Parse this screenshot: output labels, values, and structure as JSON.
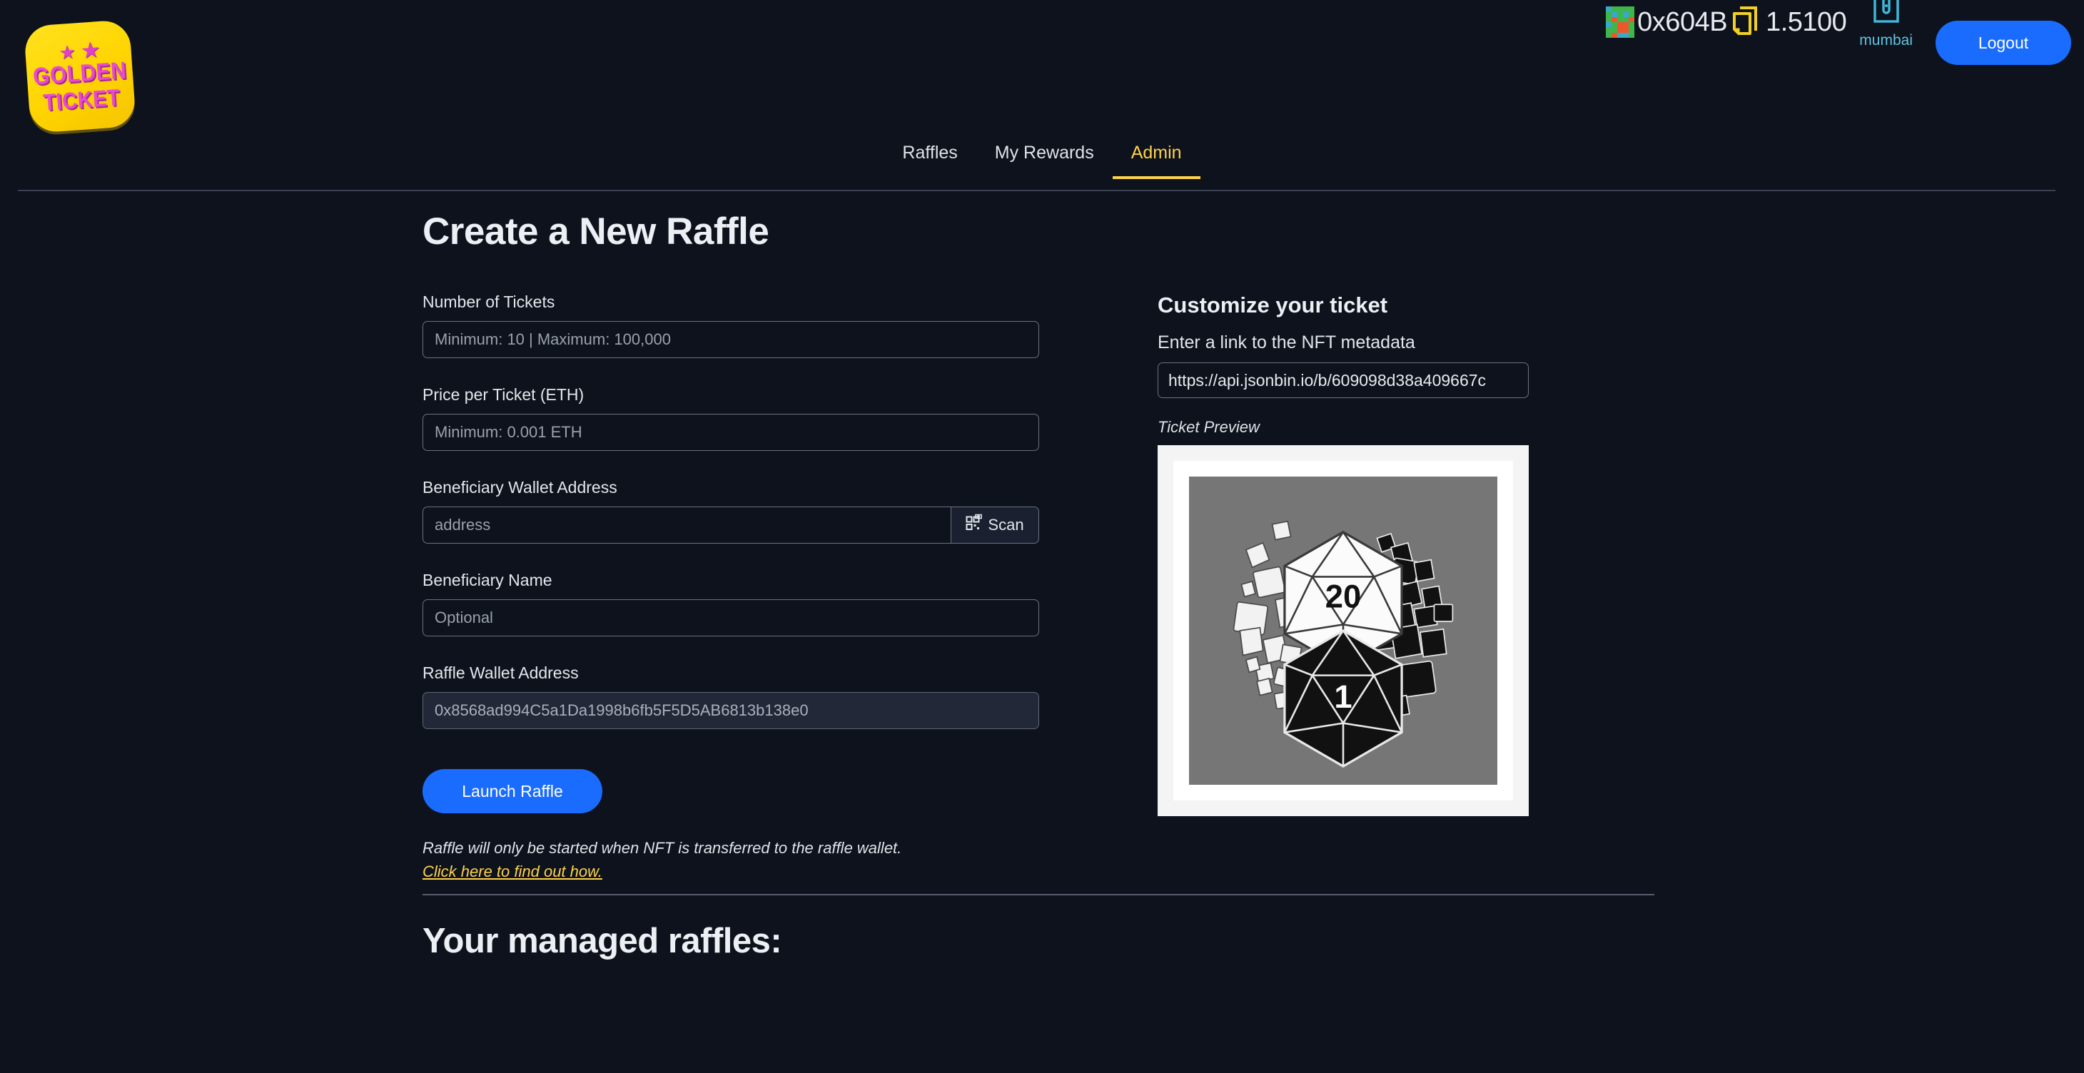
{
  "brand": {
    "logo_star": "★",
    "logo_line1": "GOLDEN",
    "logo_line2": "TICKET",
    "logo_bg": "#ffd400",
    "logo_text_color": "#e84ad0"
  },
  "header": {
    "wallet_address": "0x604B",
    "balance": "1.5100",
    "network": "mumbai",
    "logout_label": "Logout",
    "identicon_name": "identicon-avatar",
    "ticket_icon_color": "#f2d024",
    "network_icon_color": "#3fb6d8",
    "accent_blue": "#1a6cff"
  },
  "nav": {
    "items": [
      {
        "label": "Raffles",
        "active": false
      },
      {
        "label": "My Rewards",
        "active": false
      },
      {
        "label": "Admin",
        "active": true
      }
    ],
    "active_color": "#ffd24a"
  },
  "main": {
    "page_title": "Create a New Raffle",
    "fields": {
      "tickets": {
        "label": "Number of Tickets",
        "placeholder": "Minimum: 10 | Maximum: 100,000",
        "value": ""
      },
      "price": {
        "label": "Price per Ticket (ETH)",
        "placeholder": "Minimum: 0.001 ETH",
        "value": ""
      },
      "beneficiary_address": {
        "label": "Beneficiary Wallet Address",
        "placeholder": "address",
        "value": "",
        "scan_label": "Scan"
      },
      "beneficiary_name": {
        "label": "Beneficiary Name",
        "placeholder": "Optional",
        "value": ""
      },
      "raffle_wallet": {
        "label": "Raffle Wallet Address",
        "placeholder": "0x8568ad994C5a1Da1998b6fb5F5D5AB6813b138e0",
        "value": "",
        "disabled": true
      }
    },
    "launch_label": "Launch Raffle",
    "note": "Raffle will only be started when NFT is transferred to the raffle wallet.",
    "note_link": "Click here to find out how.",
    "managed_title": "Your managed raffles:"
  },
  "customize": {
    "title": "Customize your ticket",
    "metadata_label": "Enter a link to the NFT metadata",
    "metadata_value": "https://api.jsonbin.io/b/609098d38a409667c",
    "metadata_placeholder": "https://",
    "preview_caption": "Ticket Preview",
    "preview_art": {
      "description": "polyhedral-dice-yin-yang",
      "die_top_number": "20",
      "die_bottom_number": "1",
      "background": "#767676",
      "frame": "#ffffff"
    }
  }
}
